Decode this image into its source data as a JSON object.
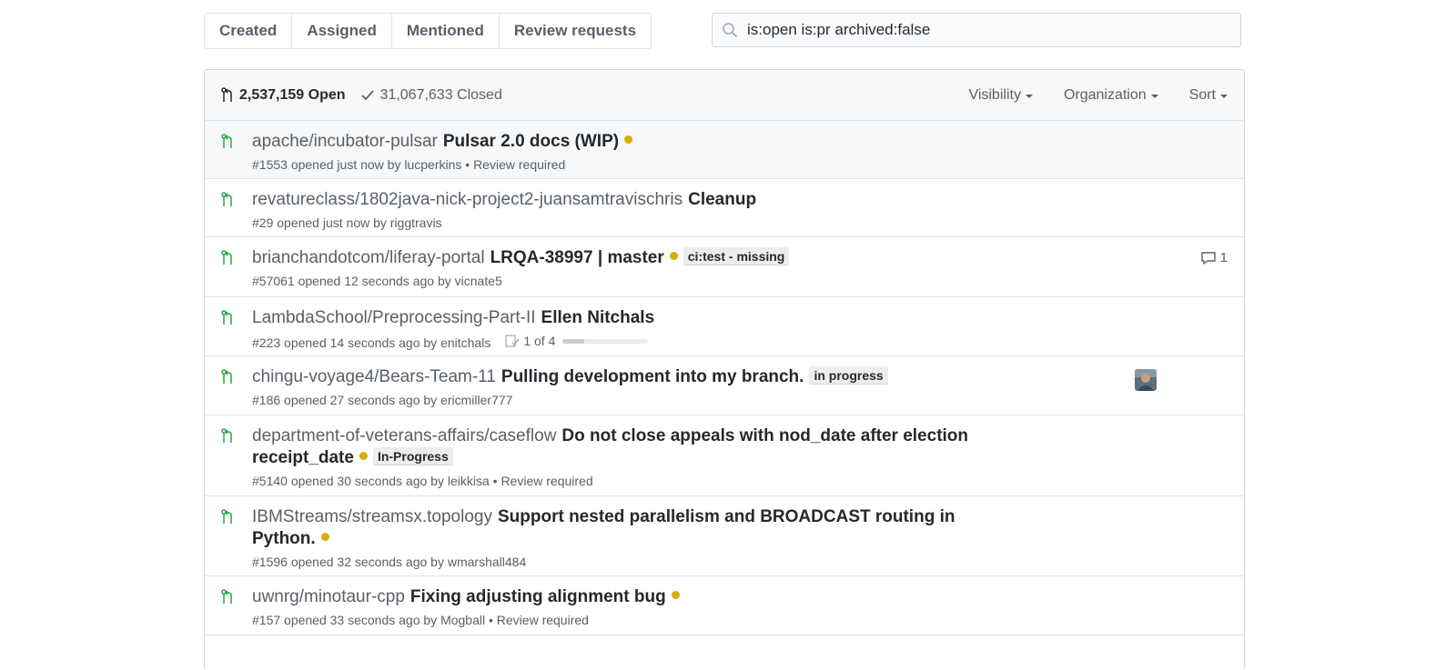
{
  "subnav": {
    "items": [
      {
        "label": "Created"
      },
      {
        "label": "Assigned"
      },
      {
        "label": "Mentioned"
      },
      {
        "label": "Review requests"
      }
    ]
  },
  "search": {
    "value": "is:open is:pr archived:false",
    "icon": "search-icon"
  },
  "header": {
    "open_label": "2,537,159 Open",
    "closed_label": "31,067,633 Closed",
    "filters": [
      {
        "label": "Visibility"
      },
      {
        "label": "Organization"
      },
      {
        "label": "Sort"
      }
    ]
  },
  "colors": {
    "pr_open": "#28a745",
    "status_pending": "#dbab09",
    "link_gray": "#586069"
  },
  "prs": [
    {
      "repo": "apache/incubator-pulsar",
      "title": "Pulsar 2.0 docs (WIP)",
      "meta_pre": "#1553 opened just now by",
      "author": "lucperkins",
      "meta_post": " • Review required"
    },
    {
      "repo": "revatureclass/1802java-nick-project2-juansamtravischris",
      "title": "Cleanup",
      "meta_pre": "#29 opened just now by",
      "author": "riggtravis",
      "meta_post": ""
    },
    {
      "repo": "brianchandotcom/liferay-portal",
      "title": "LRQA-38997 | master",
      "label": "ci:test - missing",
      "meta_pre": "#57061 opened 12 seconds ago by",
      "author": "vicnate5",
      "meta_post": "",
      "comments": "1"
    },
    {
      "repo": "LambdaSchool/Preprocessing-Part-II",
      "title": "Ellen Nitchals",
      "meta_pre": "#223 opened 14 seconds ago by",
      "author": "enitchals",
      "meta_post": "",
      "tasks": "1 of 4",
      "task_progress": 0.25
    },
    {
      "repo": "chingu-voyage4/Bears-Team-11",
      "title": "Pulling development into my branch.",
      "label": "in progress",
      "meta_pre": "#186 opened 27 seconds ago by",
      "author": "ericmiller777",
      "meta_post": ""
    },
    {
      "repo": "department-of-veterans-affairs/caseflow",
      "title": "Do not close appeals with nod_date after election receipt_date",
      "label": "In-Progress",
      "meta_pre": "#5140 opened 30 seconds ago by",
      "author": "leikkisa",
      "meta_post": " • Review required"
    },
    {
      "repo": "IBMStreams/streamsx.topology",
      "title": "Support nested parallelism and BROADCAST routing in Python.",
      "meta_pre": "#1596 opened 32 seconds ago by",
      "author": "wmarshall484",
      "meta_post": ""
    },
    {
      "repo": "uwnrg/minotaur-cpp",
      "title": "Fixing adjusting alignment bug",
      "meta_pre": "#157 opened 33 seconds ago by",
      "author": "Mogball",
      "meta_post": " • Review required"
    }
  ]
}
